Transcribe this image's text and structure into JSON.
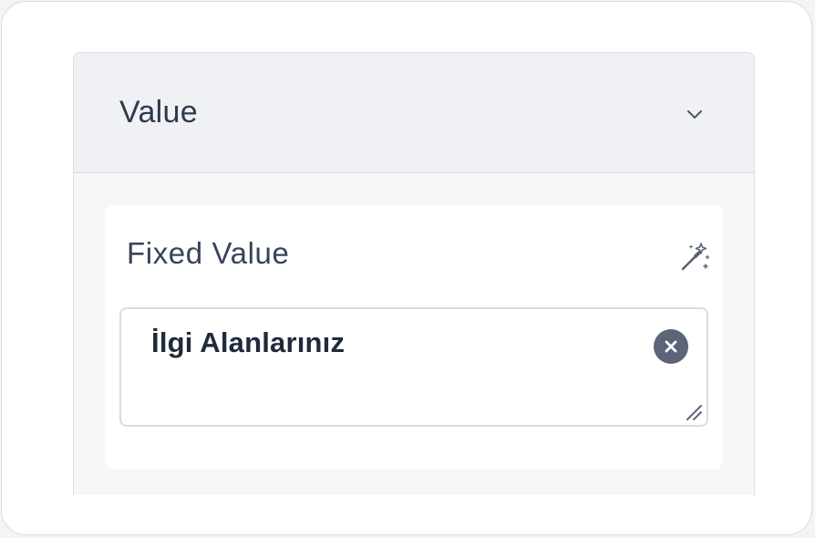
{
  "section": {
    "title": "Value",
    "toggle_icon": "chevron-down-icon"
  },
  "field": {
    "label": "Fixed Value",
    "action_icon": "magic-wand-icon",
    "value": "İlgi Alanlarınız",
    "clear_icon": "close-circle-icon",
    "resize_icon": "resize-handle-icon"
  },
  "colors": {
    "text_primary": "#2e3a4f",
    "header_bg": "#eff1f4",
    "clear_button": "#5b6577"
  }
}
